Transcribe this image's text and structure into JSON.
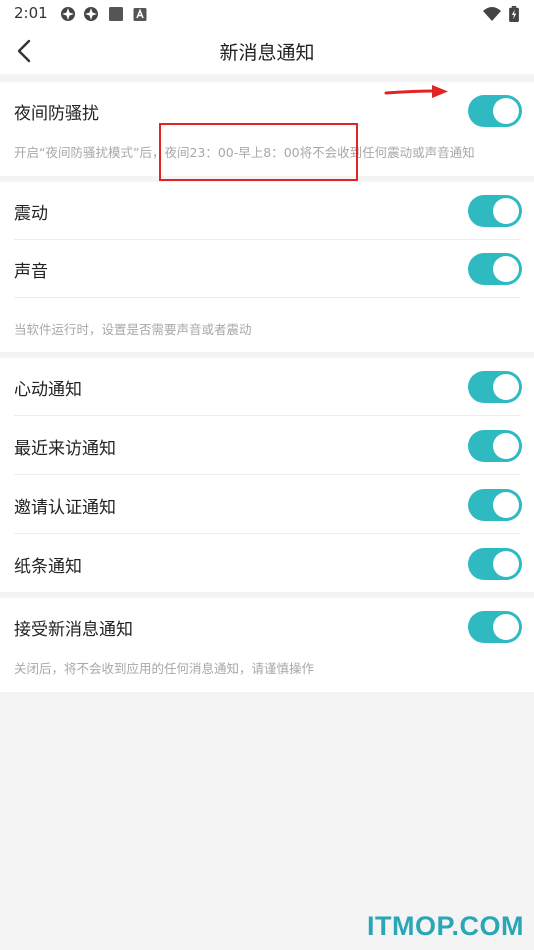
{
  "status_bar": {
    "time": "2:01",
    "icons": [
      "signal-app-icon",
      "signal-app-icon",
      "square-app-icon",
      "a-app-icon",
      "wifi-icon",
      "battery-icon"
    ]
  },
  "header": {
    "title": "新消息通知",
    "back_icon": "chevron-left-icon"
  },
  "sections": {
    "night": {
      "label": "夜间防骚扰",
      "enabled": true,
      "hint": "开启“夜间防骚扰模式”后，夜间23：00-早上8：00将不会收到任何震动或声音通知"
    },
    "alerts": {
      "vibrate_label": "震动",
      "vibrate_enabled": true,
      "sound_label": "声音",
      "sound_enabled": true,
      "hint": "当软件运行时，设置是否需要声音或者震动"
    },
    "notifications": {
      "items": [
        {
          "label": "心动通知",
          "enabled": true
        },
        {
          "label": "最近来访通知",
          "enabled": true
        },
        {
          "label": "邀请认证通知",
          "enabled": true
        },
        {
          "label": "纸条通知",
          "enabled": true
        }
      ]
    },
    "receive": {
      "label": "接受新消息通知",
      "enabled": true,
      "hint": "关闭后，将不会收到应用的任何消息通知，请谨慎操作"
    }
  },
  "colors": {
    "toggle_on": "#2fb9c0",
    "annotation": "#e02424",
    "watermark": "#2aa7b6"
  },
  "watermark": "ITMOP.COM"
}
